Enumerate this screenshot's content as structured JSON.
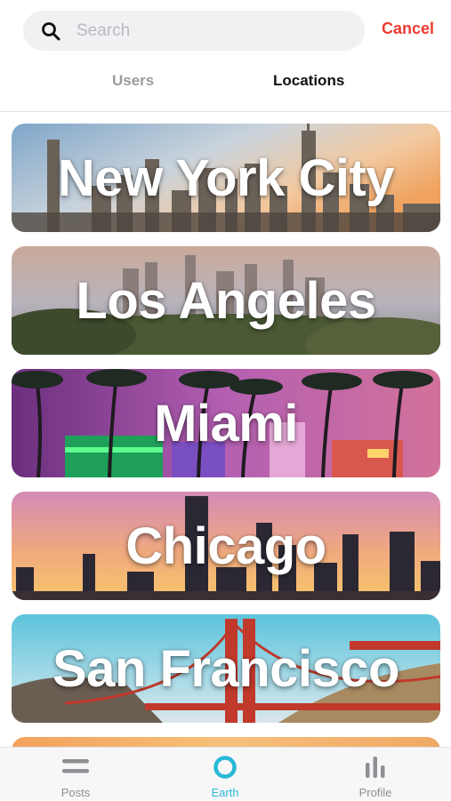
{
  "search": {
    "placeholder": "Search",
    "value": "",
    "cancel_label": "Cancel"
  },
  "tabs": [
    {
      "label": "Users",
      "active": false
    },
    {
      "label": "Locations",
      "active": true
    }
  ],
  "locations": [
    {
      "name": "New York City"
    },
    {
      "name": "Los Angeles"
    },
    {
      "name": "Miami"
    },
    {
      "name": "Chicago"
    },
    {
      "name": "San Francisco"
    }
  ],
  "tabbar": {
    "items": [
      {
        "label": "Posts",
        "icon": "menu-lines-icon",
        "active": false
      },
      {
        "label": "Earth",
        "icon": "ring-icon",
        "active": true
      },
      {
        "label": "Profile",
        "icon": "bar-chart-icon",
        "active": false
      }
    ]
  },
  "colors": {
    "accent": "#29b8d6",
    "cancel": "#ec3b32",
    "inactive": "#8e8e93"
  }
}
